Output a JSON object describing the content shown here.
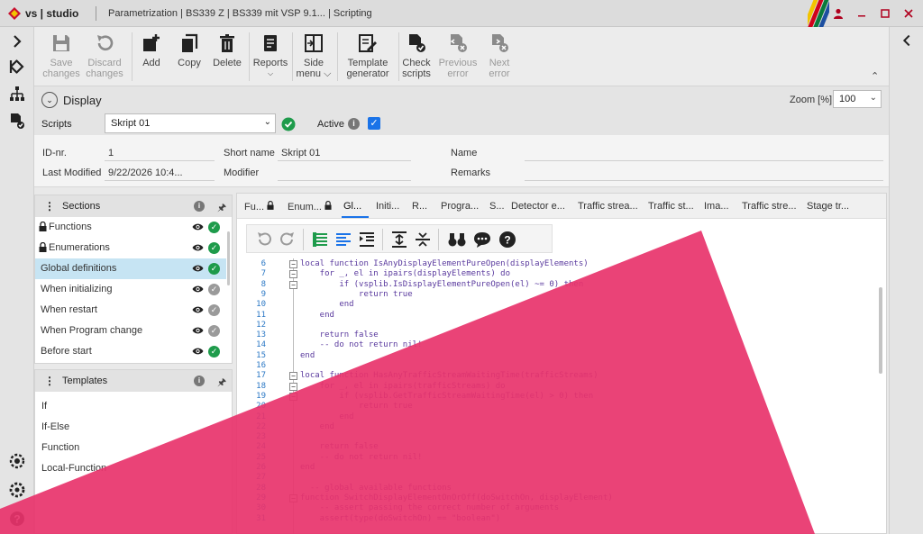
{
  "window": {
    "brand": "vs | studio",
    "title": "Parametrization  |  BS339 Z  |  BS339 mit VSP 9.1...  |  Scripting",
    "stripe_colors": [
      "#f2c300",
      "#d0021b",
      "#0a7a3c",
      "#1d4fa0"
    ],
    "accent_color": "#b0001e"
  },
  "toolbar": {
    "save": {
      "label": "Save changes",
      "line1": "Save",
      "line2": "changes"
    },
    "discard": {
      "label": "Discard changes",
      "line1": "Discard",
      "line2": "changes"
    },
    "add": "Add",
    "copy": "Copy",
    "delete": "Delete",
    "reports": "Reports",
    "side_menu": {
      "line1": "Side",
      "line2": "menu"
    },
    "template_generator": {
      "line1": "Template",
      "line2": "generator"
    },
    "check_scripts": {
      "line1": "Check",
      "line2": "scripts"
    },
    "previous_error": {
      "line1": "Previous",
      "line2": "error"
    },
    "next_error": {
      "line1": "Next",
      "line2": "error"
    }
  },
  "display": {
    "title": "Display",
    "zoom_label": "Zoom [%]",
    "zoom_value": "100"
  },
  "scripts": {
    "label": "Scripts",
    "selected": "Skript  01",
    "active_label": "Active",
    "active_checked": true
  },
  "meta": {
    "id_label": "ID-nr.",
    "id_value": "1",
    "short_name_label": "Short name",
    "short_name_value": "Skript  01",
    "name_label": "Name",
    "last_modified_label": "Last Modified",
    "last_modified_value": "9/22/2026 10:4...",
    "modifier_label": "Modifier",
    "remarks_label": "Remarks"
  },
  "sections": {
    "title": "Sections",
    "items": [
      {
        "label": "Functions",
        "locked": true,
        "status": "ok"
      },
      {
        "label": "Enumerations",
        "locked": true,
        "status": "ok"
      },
      {
        "label": "Global definitions",
        "locked": false,
        "status": "ok",
        "selected": true
      },
      {
        "label": "When initializing",
        "locked": false,
        "status": "grey"
      },
      {
        "label": "When restart",
        "locked": false,
        "status": "grey"
      },
      {
        "label": "When Program change",
        "locked": false,
        "status": "grey"
      },
      {
        "label": "Before start",
        "locked": false,
        "status": "ok"
      }
    ]
  },
  "templates": {
    "title": "Templates",
    "items": [
      "If",
      "If-Else",
      "Function",
      "Local-Function"
    ]
  },
  "tabs": [
    {
      "label": "Fu...",
      "locked": true
    },
    {
      "label": "Enum...",
      "locked": true
    },
    {
      "label": "Gl...",
      "active": true
    },
    {
      "label": "Initi..."
    },
    {
      "label": "R..."
    },
    {
      "label": "Progra..."
    },
    {
      "label": "S..."
    },
    {
      "label": "Detector e..."
    },
    {
      "label": "Traffic strea..."
    },
    {
      "label": "Traffic st..."
    },
    {
      "label": "Ima..."
    },
    {
      "label": "Traffic stre..."
    },
    {
      "label": "Stage tr..."
    }
  ],
  "code": [
    {
      "n": "6",
      "fold": "minus",
      "t": "local function IsAnyDisplayElementPureOpen(displayElements)"
    },
    {
      "n": "7",
      "fold": "minus",
      "t": "    for _, el in ipairs(displayElements) do"
    },
    {
      "n": "8",
      "fold": "minus",
      "t": "        if (vsplib.IsDisplayElementPureOpen(el) ~= 0) then"
    },
    {
      "n": "9",
      "fold": "",
      "t": "            return true"
    },
    {
      "n": "10",
      "fold": "",
      "t": "        end"
    },
    {
      "n": "11",
      "fold": "",
      "t": "    end"
    },
    {
      "n": "12",
      "fold": "",
      "t": ""
    },
    {
      "n": "13",
      "fold": "",
      "t": "    return false"
    },
    {
      "n": "14",
      "fold": "",
      "t": "    -- do not return nil!"
    },
    {
      "n": "15",
      "fold": "",
      "t": "end"
    },
    {
      "n": "16",
      "fold": "",
      "t": ""
    },
    {
      "n": "17",
      "fold": "minus",
      "t": "local function HasAnyTrafficStreamWaitingTime(trafficStreams)"
    },
    {
      "n": "18",
      "fold": "minus",
      "t": "    for _, el in ipairs(trafficStreams) do"
    },
    {
      "n": "19",
      "fold": "minus",
      "t": "        if (vsplib.GetTrafficStreamWaitingTime(el) > 0) then"
    },
    {
      "n": "20",
      "fold": "",
      "t": "            return true"
    },
    {
      "n": "21",
      "fold": "",
      "t": "        end"
    },
    {
      "n": "22",
      "fold": "",
      "t": "    end"
    },
    {
      "n": "23",
      "fold": "",
      "t": ""
    },
    {
      "n": "24",
      "fold": "",
      "t": "    return false"
    },
    {
      "n": "25",
      "fold": "",
      "t": "    -- do not return nil!"
    },
    {
      "n": "26",
      "fold": "",
      "t": "end"
    },
    {
      "n": "27",
      "fold": "",
      "t": ""
    },
    {
      "n": "28",
      "fold": "",
      "t": "  -- global available functions"
    },
    {
      "n": "29",
      "fold": "minus",
      "t": "function SwitchDisplayElementOnOrOff(doSwitchOn, displayElement)"
    },
    {
      "n": "30",
      "fold": "",
      "t": "    -- assert passing the correct number of arguments"
    },
    {
      "n": "31",
      "fold": "",
      "t": "    assert(type(doSwitchOn) == \"boolean\")"
    }
  ],
  "overlay_color": "#e8336b"
}
